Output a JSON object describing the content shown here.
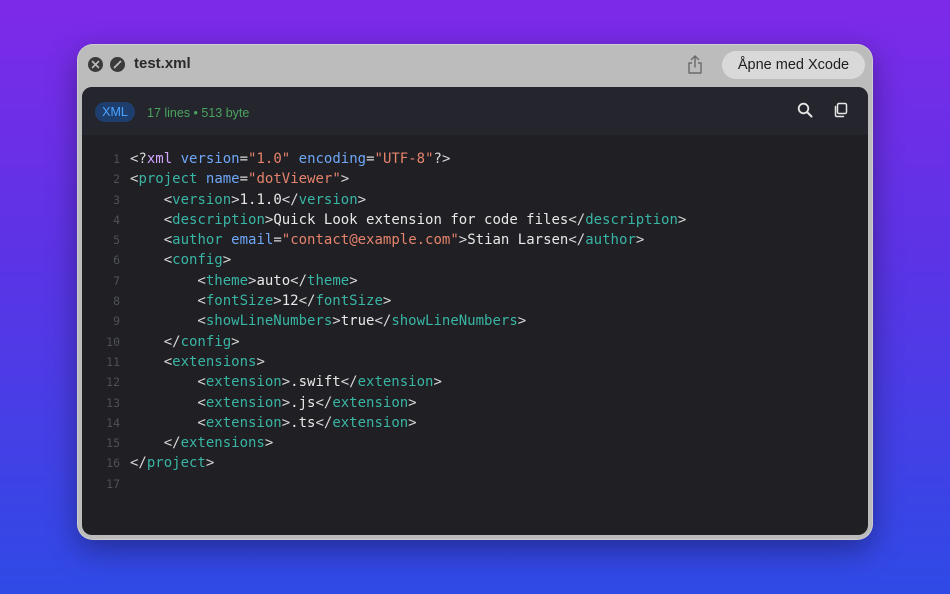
{
  "window": {
    "file_name": "test.xml",
    "open_button_label": "Åpne med Xcode"
  },
  "header": {
    "language_badge": "XML",
    "file_info": "17 lines • 513 byte"
  },
  "colors": {
    "background_top": "#7d2ae8",
    "background_bottom": "#2f4ae6",
    "tag": "#39b5a4",
    "attribute": "#6fa7f7",
    "string": "#e5836b",
    "text": "#e8e8e8",
    "badge_text": "#4ba3ff",
    "file_info": "#4aa35e"
  },
  "icons": {
    "close": "close-icon",
    "fullscreen": "fullscreen-icon",
    "share": "share-icon",
    "search": "search-icon",
    "copy": "copy-icon"
  },
  "code": {
    "lines": [
      {
        "n": "1",
        "tokens": [
          [
            "punct",
            "<?"
          ],
          [
            "pi",
            "xml"
          ],
          [
            "punct",
            " "
          ],
          [
            "attr",
            "version"
          ],
          [
            "punct",
            "="
          ],
          [
            "str",
            "\"1.0\""
          ],
          [
            "punct",
            " "
          ],
          [
            "attr",
            "encoding"
          ],
          [
            "punct",
            "="
          ],
          [
            "str",
            "\"UTF-8\""
          ],
          [
            "punct",
            "?>"
          ]
        ]
      },
      {
        "n": "2",
        "tokens": [
          [
            "punct",
            "<"
          ],
          [
            "tag",
            "project"
          ],
          [
            "punct",
            " "
          ],
          [
            "attr",
            "name"
          ],
          [
            "punct",
            "="
          ],
          [
            "str",
            "\"dotViewer\""
          ],
          [
            "punct",
            ">"
          ]
        ]
      },
      {
        "n": "3",
        "tokens": [
          [
            "punct",
            "    <"
          ],
          [
            "tag",
            "version"
          ],
          [
            "punct",
            ">"
          ],
          [
            "text",
            "1.1.0"
          ],
          [
            "punct",
            "</"
          ],
          [
            "tag",
            "version"
          ],
          [
            "punct",
            ">"
          ]
        ]
      },
      {
        "n": "4",
        "tokens": [
          [
            "punct",
            "    <"
          ],
          [
            "tag",
            "description"
          ],
          [
            "punct",
            ">"
          ],
          [
            "text",
            "Quick Look extension for code files"
          ],
          [
            "punct",
            "</"
          ],
          [
            "tag",
            "description"
          ],
          [
            "punct",
            ">"
          ]
        ]
      },
      {
        "n": "5",
        "tokens": [
          [
            "punct",
            "    <"
          ],
          [
            "tag",
            "author"
          ],
          [
            "punct",
            " "
          ],
          [
            "attr",
            "email"
          ],
          [
            "punct",
            "="
          ],
          [
            "str",
            "\"contact@example.com\""
          ],
          [
            "punct",
            ">"
          ],
          [
            "text",
            "Stian Larsen"
          ],
          [
            "punct",
            "</"
          ],
          [
            "tag",
            "author"
          ],
          [
            "punct",
            ">"
          ]
        ]
      },
      {
        "n": "6",
        "tokens": [
          [
            "punct",
            "    <"
          ],
          [
            "tag",
            "config"
          ],
          [
            "punct",
            ">"
          ]
        ]
      },
      {
        "n": "7",
        "tokens": [
          [
            "punct",
            "        <"
          ],
          [
            "tag",
            "theme"
          ],
          [
            "punct",
            ">"
          ],
          [
            "text",
            "auto"
          ],
          [
            "punct",
            "</"
          ],
          [
            "tag",
            "theme"
          ],
          [
            "punct",
            ">"
          ]
        ]
      },
      {
        "n": "8",
        "tokens": [
          [
            "punct",
            "        <"
          ],
          [
            "tag",
            "fontSize"
          ],
          [
            "punct",
            ">"
          ],
          [
            "text",
            "12"
          ],
          [
            "punct",
            "</"
          ],
          [
            "tag",
            "fontSize"
          ],
          [
            "punct",
            ">"
          ]
        ]
      },
      {
        "n": "9",
        "tokens": [
          [
            "punct",
            "        <"
          ],
          [
            "tag",
            "showLineNumbers"
          ],
          [
            "punct",
            ">"
          ],
          [
            "text",
            "true"
          ],
          [
            "punct",
            "</"
          ],
          [
            "tag",
            "showLineNumbers"
          ],
          [
            "punct",
            ">"
          ]
        ]
      },
      {
        "n": "10",
        "tokens": [
          [
            "punct",
            "    </"
          ],
          [
            "tag",
            "config"
          ],
          [
            "punct",
            ">"
          ]
        ]
      },
      {
        "n": "11",
        "tokens": [
          [
            "punct",
            "    <"
          ],
          [
            "tag",
            "extensions"
          ],
          [
            "punct",
            ">"
          ]
        ]
      },
      {
        "n": "12",
        "tokens": [
          [
            "punct",
            "        <"
          ],
          [
            "tag",
            "extension"
          ],
          [
            "punct",
            ">"
          ],
          [
            "text",
            ".swift"
          ],
          [
            "punct",
            "</"
          ],
          [
            "tag",
            "extension"
          ],
          [
            "punct",
            ">"
          ]
        ]
      },
      {
        "n": "13",
        "tokens": [
          [
            "punct",
            "        <"
          ],
          [
            "tag",
            "extension"
          ],
          [
            "punct",
            ">"
          ],
          [
            "text",
            ".js"
          ],
          [
            "punct",
            "</"
          ],
          [
            "tag",
            "extension"
          ],
          [
            "punct",
            ">"
          ]
        ]
      },
      {
        "n": "14",
        "tokens": [
          [
            "punct",
            "        <"
          ],
          [
            "tag",
            "extension"
          ],
          [
            "punct",
            ">"
          ],
          [
            "text",
            ".ts"
          ],
          [
            "punct",
            "</"
          ],
          [
            "tag",
            "extension"
          ],
          [
            "punct",
            ">"
          ]
        ]
      },
      {
        "n": "15",
        "tokens": [
          [
            "punct",
            "    </"
          ],
          [
            "tag",
            "extensions"
          ],
          [
            "punct",
            ">"
          ]
        ]
      },
      {
        "n": "16",
        "tokens": [
          [
            "punct",
            "</"
          ],
          [
            "tag",
            "project"
          ],
          [
            "punct",
            ">"
          ]
        ]
      },
      {
        "n": "17",
        "tokens": []
      }
    ]
  }
}
